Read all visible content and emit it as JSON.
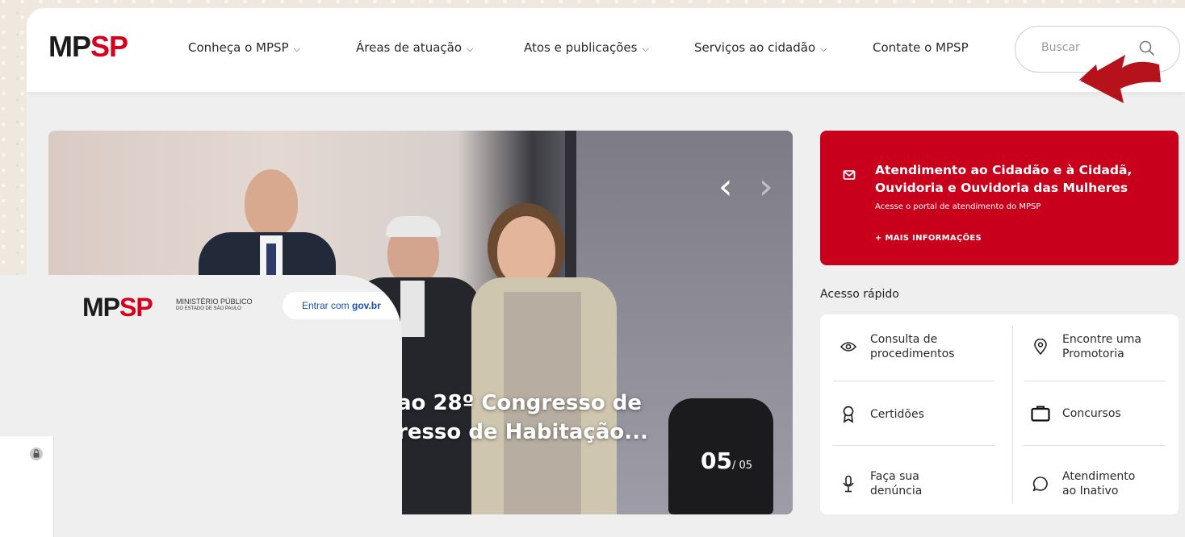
{
  "header": {
    "logo": {
      "mp": "MP",
      "sp": "SP"
    },
    "nav": [
      {
        "label": "Conheça o MPSP",
        "dropdown": true
      },
      {
        "label": "Áreas de atuação",
        "dropdown": true
      },
      {
        "label": "Atos e publicações",
        "dropdown": true
      },
      {
        "label": "Serviços ao cidadão",
        "dropdown": true
      },
      {
        "label": "Contate o MPSP",
        "dropdown": false
      }
    ],
    "search": {
      "placeholder": "Buscar",
      "value": ""
    }
  },
  "hero": {
    "caption_line1": "ao 28º Congresso de",
    "caption_line2": "resso de Habitação...",
    "counter_current": "05",
    "counter_total": "/ 05",
    "prev_glyph": "‹",
    "next_glyph": "›"
  },
  "red_card": {
    "title_line1": "Atendimento ao Cidadão e à Cidadã,",
    "title_line2": "Ouvidoria e Ouvidoria das Mulheres",
    "subtitle": "Acesse o portal de atendimento do MPSP",
    "more": "+ MAIS INFORMAÇÕES",
    "icon": "mail-icon"
  },
  "quick_access": {
    "title": "Acesso rápido",
    "items": [
      {
        "line1": "Consulta de",
        "line2": "procedimentos",
        "icon": "eye-icon"
      },
      {
        "line1": "Encontre uma",
        "line2": "Promotoria",
        "icon": "location-pin-icon"
      },
      {
        "line1": "Certidões",
        "line2": "",
        "icon": "award-ribbon-icon"
      },
      {
        "line1": "Concursos",
        "line2": "",
        "icon": "briefcase-icon"
      },
      {
        "line1": "Faça sua",
        "line2": "denúncia",
        "icon": "microphone-icon"
      },
      {
        "line1": "Atendimento",
        "line2": "ao Inativo",
        "icon": "chat-bubble-icon"
      }
    ]
  },
  "login_panel": {
    "logo": {
      "mp": "MP",
      "sp": "SP"
    },
    "institution_line1": "MINISTÉRIO PÚBLICO",
    "institution_line2": "DO ESTADO DE SÃO PAULO",
    "gov_button_prefix": "Entrar com ",
    "gov_button_brand": "gov.br"
  },
  "colors": {
    "brand_red": "#c8001b",
    "logo_red": "#d6001c",
    "annotation_arrow": "#b5121b",
    "gov_blue": "#1351b4"
  }
}
